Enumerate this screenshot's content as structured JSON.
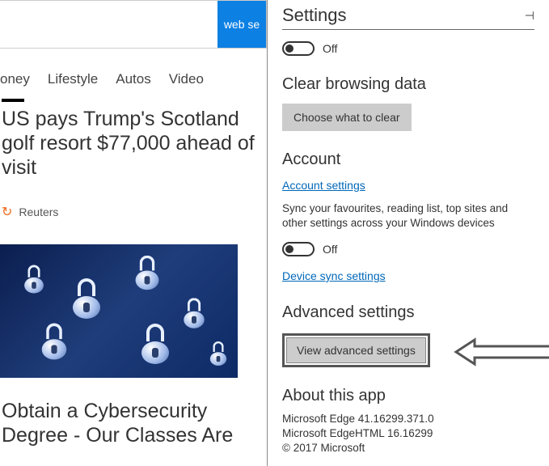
{
  "search": {
    "btn": "web se"
  },
  "nav": [
    "oney",
    "Lifestyle",
    "Autos",
    "Video"
  ],
  "article1": {
    "title": "US pays Trump's Scotland golf resort $77,000 ahead of visit",
    "source": "Reuters"
  },
  "article2": {
    "title": "Obtain a Cybersecurity Degree - Our Classes Are"
  },
  "settings": {
    "title": "Settings",
    "toggle1_label": "Off",
    "clear_h": "Clear browsing data",
    "clear_btn": "Choose what to clear",
    "account_h": "Account",
    "account_link": "Account settings",
    "sync_text": "Sync your favourites, reading list, top sites and other settings across your Windows devices",
    "toggle2_label": "Off",
    "device_link": "Device sync settings",
    "adv_h": "Advanced settings",
    "adv_btn": "View advanced settings",
    "about_h": "About this app",
    "about_line1": "Microsoft Edge 41.16299.371.0",
    "about_line2": "Microsoft EdgeHTML 16.16299",
    "about_line3": "© 2017 Microsoft"
  }
}
